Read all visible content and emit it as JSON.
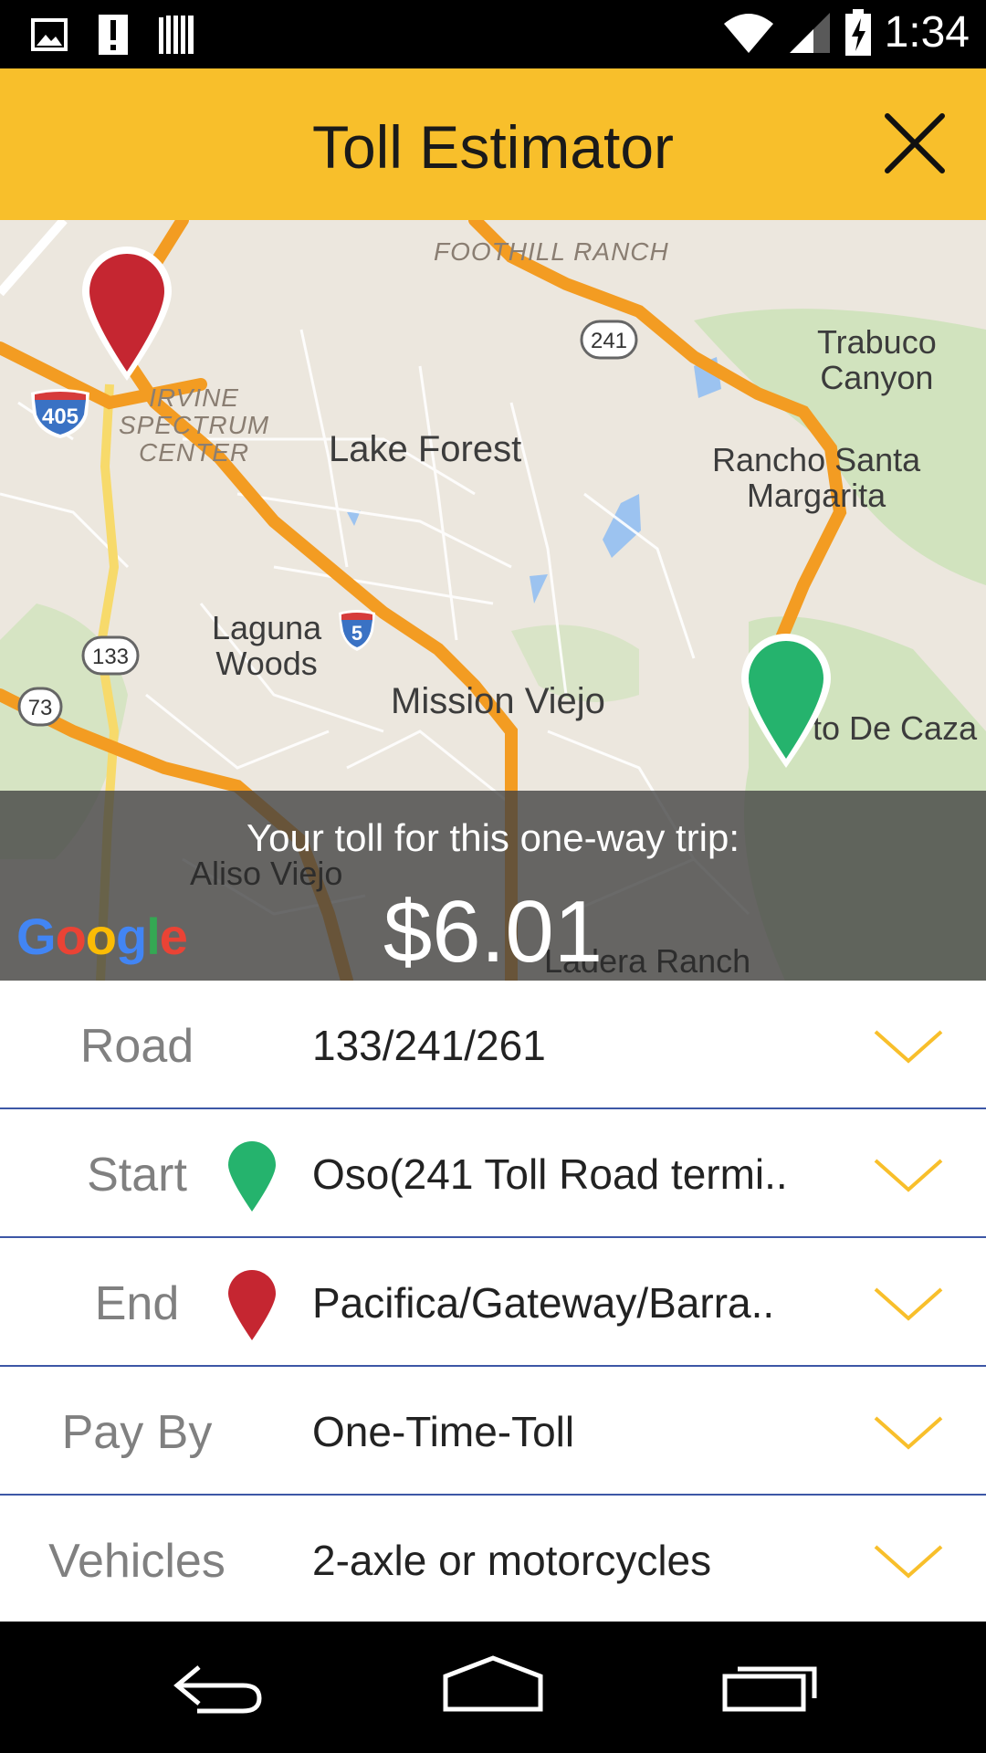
{
  "status_bar": {
    "time": "1:34",
    "icons": [
      "image-icon",
      "alert-icon",
      "barcode-icon",
      "wifi-icon",
      "signal-icon",
      "battery-charging-icon"
    ]
  },
  "app_bar": {
    "title": "Toll Estimator",
    "close_icon": "close-icon",
    "background_color": "#f8bf2b"
  },
  "map": {
    "labels": {
      "foothill_ranch": "FOOTHILL RANCH",
      "trabuco_canyon": "Trabuco\nCanyon",
      "irvine_spectrum": "IRVINE\nSPECTRUM\nCENTER",
      "lake_forest": "Lake Forest",
      "rancho_santa_margarita": "Rancho Santa\nMargarita",
      "laguna_woods": "Laguna\nWoods",
      "mission_viejo": "Mission Viejo",
      "coto_de_caza": "to De Caza",
      "aliso_viejo": "Aliso Viejo",
      "ladera_ranch": "Ladera Ranch"
    },
    "shields": {
      "h405": "405",
      "h241": "241",
      "h5": "5",
      "h133": "133",
      "h73": "73"
    },
    "google_logo": "Google",
    "start_pin_color": "#25b36d",
    "end_pin_color": "#c52631"
  },
  "toll": {
    "caption": "Your toll for this one-way trip:",
    "amount": "$6.01"
  },
  "form": {
    "road": {
      "label": "Road",
      "value": "133/241/261"
    },
    "start": {
      "label": "Start",
      "value": "Oso(241 Toll Road termi.."
    },
    "end": {
      "label": "End",
      "value": "Pacifica/Gateway/Barra.."
    },
    "pay_by": {
      "label": "Pay By",
      "value": "One-Time-Toll"
    },
    "vehicles": {
      "label": "Vehicles",
      "value": "2-axle or motorcycles"
    },
    "chevron_color": "#f8bf2b",
    "divider_color": "#3d57a6"
  },
  "nav_bar": {
    "back": "back-icon",
    "home": "home-icon",
    "recents": "recents-icon"
  }
}
